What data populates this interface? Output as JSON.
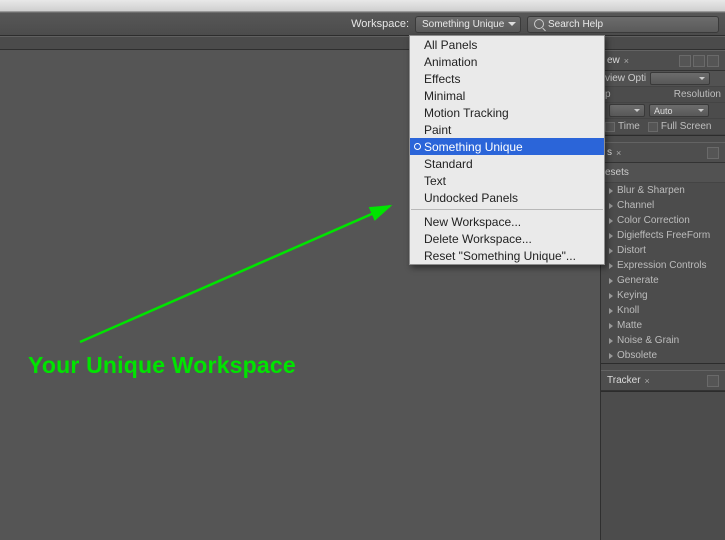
{
  "toolbar": {
    "workspace_label": "Workspace:",
    "workspace_value": "Something Unique",
    "search_placeholder": "Search Help"
  },
  "workspace_menu": {
    "items": [
      "All Panels",
      "Animation",
      "Effects",
      "Minimal",
      "Motion Tracking",
      "Paint",
      "Something Unique",
      "Standard",
      "Text",
      "Undocked Panels"
    ],
    "selected": "Something Unique",
    "actions": [
      "New Workspace...",
      "Delete Workspace...",
      "Reset \"Something Unique\"..."
    ]
  },
  "preview_panel": {
    "tab": "ew",
    "opt_label": "view Opti",
    "row2_a": "p",
    "row2_b": "Resolution",
    "auto": "Auto",
    "row3_a": "Time",
    "row3_b": "Full Screen"
  },
  "effects_panel": {
    "tab": "s",
    "header": "esets",
    "items": [
      "Blur & Sharpen",
      "Channel",
      "Color Correction",
      "Digieffects FreeForm",
      "Distort",
      "Expression Controls",
      "Generate",
      "Keying",
      "Knoll",
      "Matte",
      "Noise & Grain",
      "Obsolete"
    ]
  },
  "tracker_panel": {
    "tab": "Tracker"
  },
  "annotation": {
    "text": "Your Unique Workspace"
  }
}
